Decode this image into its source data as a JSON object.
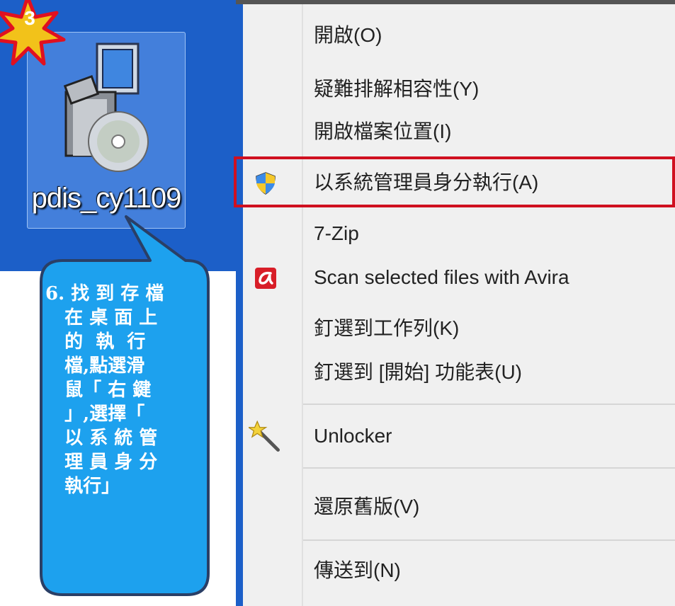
{
  "desktop": {
    "icon_label": "pdis_cy1109",
    "step_badge": "3"
  },
  "callout": {
    "lines": [
      "6. 找 到 存 檔",
      "   在 桌 面 上",
      "   的  執  行",
      "   檔,點選滑",
      "   鼠「 右 鍵",
      "   」,選擇「",
      "   以 系 統 管",
      "   理 員 身 分",
      "   執行」"
    ]
  },
  "context_menu": {
    "items": [
      {
        "label": "開啟(O)",
        "icon": ""
      },
      {
        "label": "疑難排解相容性(Y)",
        "icon": ""
      },
      {
        "label": "開啟檔案位置(I)",
        "icon": ""
      },
      {
        "label": "以系統管理員身分執行(A)",
        "icon": "uac-shield-icon",
        "highlighted": true
      },
      {
        "label": "7-Zip",
        "icon": ""
      },
      {
        "label": "Scan selected files with Avira",
        "icon": "avira-icon"
      },
      {
        "label": "釘選到工作列(K)",
        "icon": ""
      },
      {
        "label": "釘選到 [開始] 功能表(U)",
        "icon": ""
      },
      {
        "label": "Unlocker",
        "icon": "magic-wand-icon"
      },
      {
        "label": "還原舊版(V)",
        "icon": ""
      },
      {
        "label": "傳送到(N)",
        "icon": ""
      }
    ]
  },
  "colors": {
    "desktop_bg": "#1c5fc8",
    "highlight_border": "#d01020",
    "callout_fill": "#1da1ee",
    "star_fill": "#f2c21a",
    "star_stroke": "#e01020"
  }
}
